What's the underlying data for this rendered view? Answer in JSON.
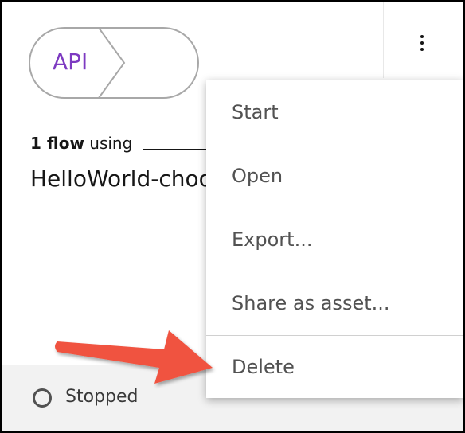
{
  "card": {
    "tag_label": "API",
    "flow_count": "1 flow",
    "flow_using": "using",
    "flow_name": "HelloWorld-chooser"
  },
  "menu": {
    "items": [
      {
        "label": "Start"
      },
      {
        "label": "Open"
      },
      {
        "label": "Export..."
      },
      {
        "label": "Share as asset..."
      },
      {
        "label": "Delete"
      }
    ]
  },
  "status": {
    "text": "Stopped"
  },
  "colors": {
    "tag_text": "#7d3ac1",
    "annotation_arrow": "#f0533f",
    "menu_text": "#525252"
  },
  "icons": {
    "overflow": "overflow-menu-vertical-icon",
    "status": "stopped-status-icon",
    "annotation": "annotation-arrow-icon"
  }
}
